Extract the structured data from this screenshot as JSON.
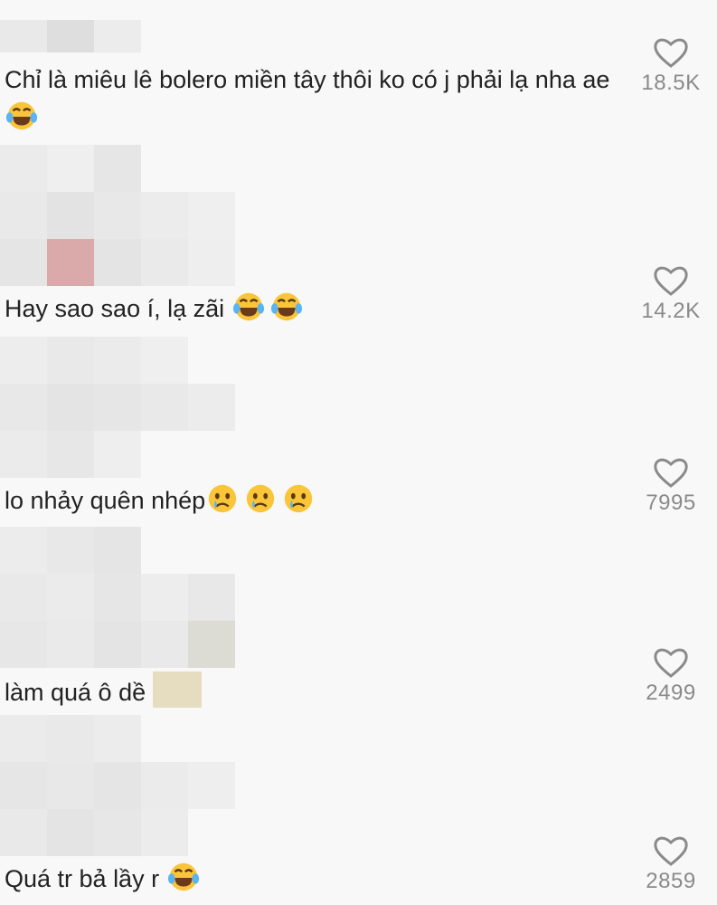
{
  "comments": [
    {
      "text": "Chỉ là miêu lê bolero miền tây thôi ko có j phải lạ nha ae",
      "emoji": [
        "laughing-tears"
      ],
      "likes": "18.5K"
    },
    {
      "text": "Hay sao sao í, lạ zãi ",
      "emoji": [
        "laughing-tears",
        "laughing-tears"
      ],
      "likes": "14.2K"
    },
    {
      "text": "lo nhảy quên nhép",
      "emoji": [
        "sad-tear",
        "sad-tear",
        "sad-tear"
      ],
      "likes": "7995"
    },
    {
      "text": "làm quá ô dề",
      "emoji": [],
      "likes": "2499"
    },
    {
      "text": "Quá tr bả lầy r ",
      "emoji": [
        "laughing-tears"
      ],
      "likes": "2859"
    }
  ],
  "icons": {
    "like": "heart-outline-icon"
  },
  "colors": {
    "background": "#f8f8f8",
    "text": "#222222",
    "count": "#8a8a8a",
    "blur": "#e4e4e4",
    "blur_accent": "#d9aaa9",
    "emoji_face": "#fbc53a"
  }
}
